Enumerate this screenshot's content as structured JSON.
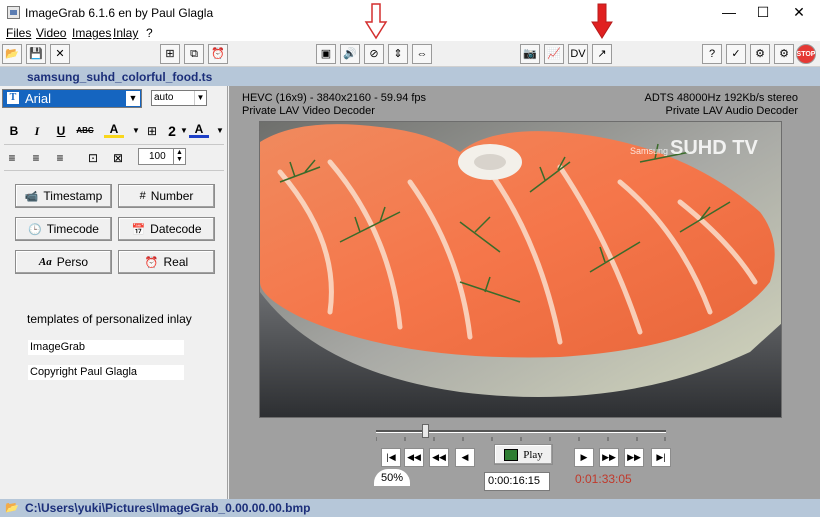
{
  "window": {
    "title": "ImageGrab 6.1.6 en by Paul Glagla",
    "minimize": "—",
    "maximize": "☐",
    "close": "✕"
  },
  "menu": [
    "Files",
    "Video",
    "Images",
    "Inlay",
    "?"
  ],
  "file": {
    "name": "samsung_suhd_colorful_food.ts"
  },
  "inlay": {
    "font": "Arial",
    "size": "auto",
    "spin_value": "100",
    "buttons": [
      "Timestamp",
      "Number",
      "Timecode",
      "Datecode",
      "Perso",
      "Real"
    ],
    "templates_label": "templates of personalized inlay",
    "templates": [
      "ImageGrab",
      "Copyright Paul Glagla"
    ]
  },
  "video": {
    "info_left_1": "HEVC (16x9) - 3840x2160 - 59.94 fps",
    "info_left_2": "Private LAV Video Decoder",
    "info_right_1": "ADTS 48000Hz 192Kb/s stereo",
    "info_right_2": "Private LAV Audio Decoder",
    "watermark": "SUHD TV",
    "watermark_small": "Samsung"
  },
  "playback": {
    "position_fraction": 0.17,
    "play_label": "Play",
    "zoom": "50%",
    "current_time": "0:00:16:15",
    "duration": "0:01:33:05"
  },
  "status": {
    "path": "C:\\Users\\yuki\\Pictures\\ImageGrab_0.00.00.00.bmp"
  },
  "colors": {
    "accent": "#1565c0",
    "duration_red": "#c0392b",
    "bar_blue": "#b6c7d9"
  }
}
